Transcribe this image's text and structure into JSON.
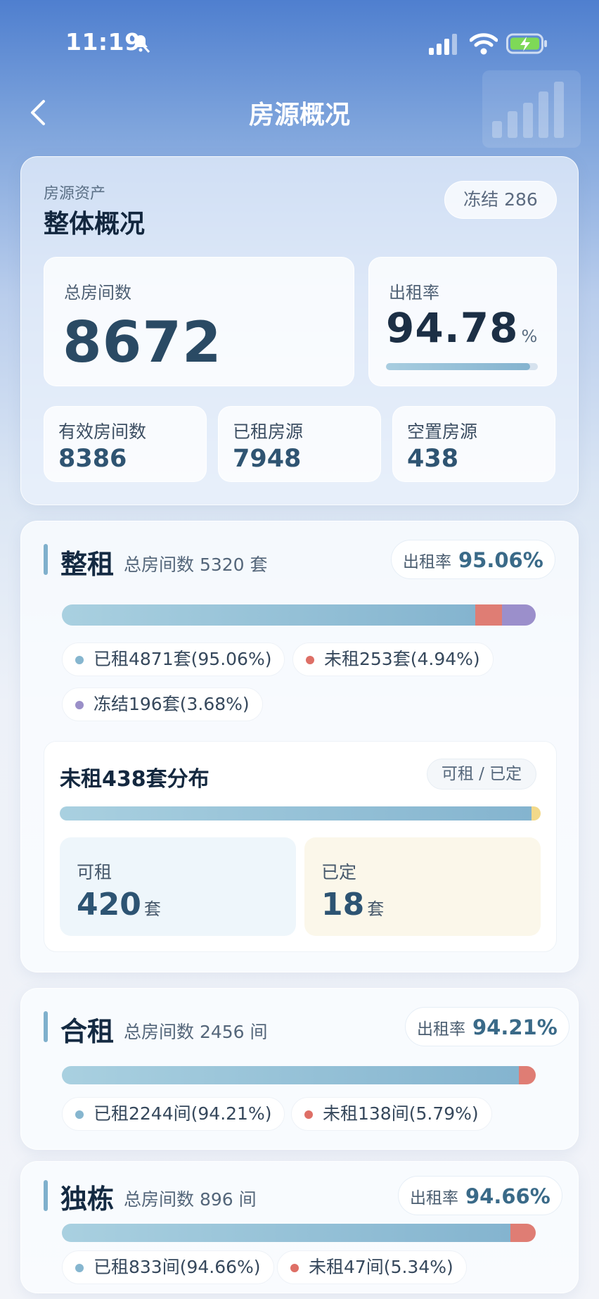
{
  "status_bar": {
    "time": "11:19"
  },
  "nav": {
    "title": "房源概况"
  },
  "overview": {
    "subtitle": "房源资产",
    "title": "整体概况",
    "frozen_label": "冻结 286",
    "total_rooms": {
      "label": "总房间数",
      "value": "8672"
    },
    "rent_rate": {
      "label": "出租率",
      "value": "94.78",
      "unit": "%",
      "fill_fraction": 0.9478
    },
    "valid_rooms": {
      "label": "有效房间数",
      "value": "8386"
    },
    "rented": {
      "label": "已租房源",
      "value": "7948"
    },
    "vacant": {
      "label": "空置房源",
      "value": "438"
    }
  },
  "whole_rent": {
    "name": "整租",
    "total": "总房间数 5320 套",
    "rate_label": "出租率",
    "rate_value": "95.06%",
    "legend": {
      "rented": "已租4871套(95.06%)",
      "unrented": "未租253套(4.94%)",
      "frozen": "冻结196套(3.68%)"
    },
    "distribution": {
      "title": "未租438套分布",
      "pill": "可租 / 已定",
      "available": {
        "label": "可租",
        "value": "420",
        "unit": "套"
      },
      "reserved": {
        "label": "已定",
        "value": "18",
        "unit": "套"
      }
    }
  },
  "shared_rent": {
    "name": "合租",
    "total": "总房间数 2456 间",
    "rate_label": "出租率",
    "rate_value": "94.21%",
    "legend": {
      "rented": "已租2244间(94.21%)",
      "unrented": "未租138间(5.79%)"
    }
  },
  "single_house": {
    "name": "独栋",
    "total": "总房间数 896 间",
    "rate_label": "出租率",
    "rate_value": "94.66%",
    "legend": {
      "rented": "已租833间(94.66%)",
      "unrented": "未租47间(5.34%)"
    }
  },
  "colors": {
    "rented": "#86b6cf",
    "unrented": "#df7d74",
    "frozen": "#9b8fcb",
    "reserved": "#f2d98a"
  }
}
